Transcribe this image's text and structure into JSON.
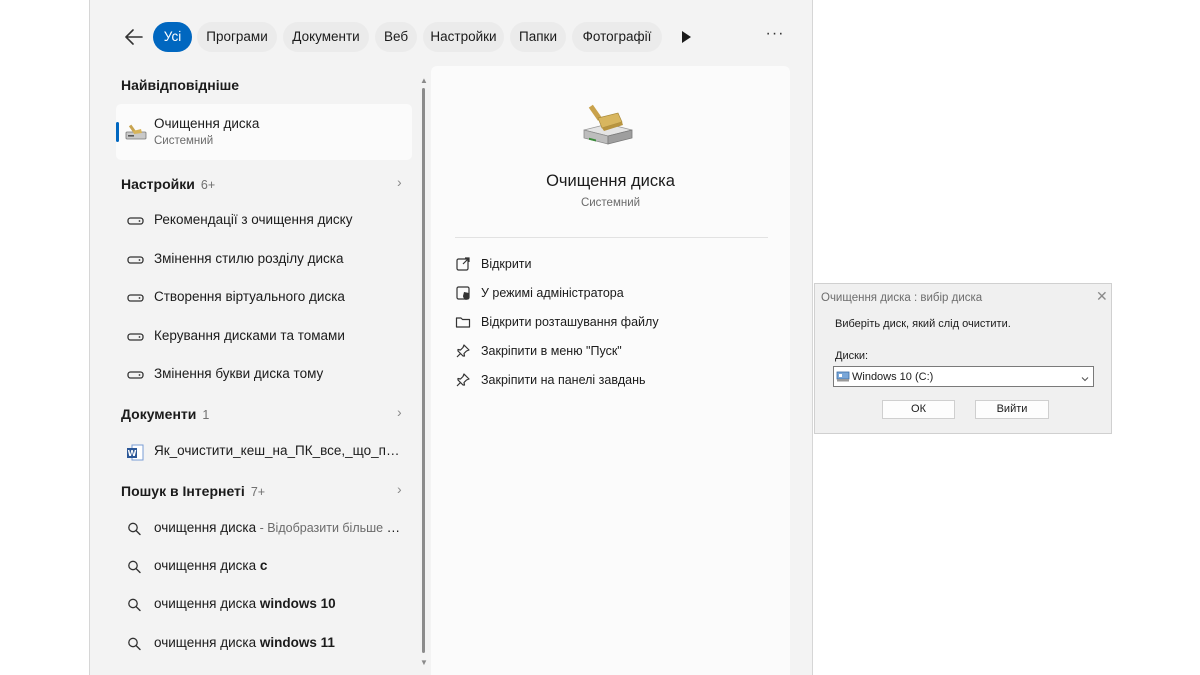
{
  "filters": {
    "items": [
      {
        "label": "Усі",
        "active": true
      },
      {
        "label": "Програми"
      },
      {
        "label": "Документи"
      },
      {
        "label": "Веб"
      },
      {
        "label": "Настройки"
      },
      {
        "label": "Папки"
      },
      {
        "label": "Фотографії"
      }
    ],
    "more_icon": "play-triangle-icon",
    "options_icon": "more-dots-icon",
    "options_label": "···"
  },
  "best_match": {
    "heading": "Найвідповідніше",
    "title": "Очищення диска",
    "subtitle": "Системний",
    "icon": "disk-cleanup-icon"
  },
  "settings_section": {
    "heading": "Настройки",
    "count": "6+",
    "items": [
      {
        "label": "Рекомендації з очищення диску"
      },
      {
        "label": "Змінення стилю розділу диска"
      },
      {
        "label": "Створення віртуального диска"
      },
      {
        "label": "Керування дисками та томами"
      },
      {
        "label": "Змінення букви диска тому"
      }
    ]
  },
  "documents_section": {
    "heading": "Документи",
    "count": "1",
    "items": [
      {
        "label": "Як_очистити_кеш_на_ПК_все,_що_потрібно_знати.docx"
      }
    ]
  },
  "web_section": {
    "heading": "Пошук в Інтернеті",
    "count": "7+",
    "items": [
      {
        "query": "очищення диска",
        "bold": "",
        "hint": " - Відобразити більше результатів"
      },
      {
        "query": "очищення диска ",
        "bold": "c",
        "hint": ""
      },
      {
        "query": "очищення диска ",
        "bold": "windows 10",
        "hint": ""
      },
      {
        "query": "очищення диска ",
        "bold": "windows 11",
        "hint": ""
      }
    ]
  },
  "detail": {
    "title": "Очищення диска",
    "subtitle": "Системний",
    "actions": [
      {
        "label": "Відкрити",
        "icon": "open-external-icon"
      },
      {
        "label": "У режимі адміністратора",
        "icon": "admin-shield-icon"
      },
      {
        "label": "Відкрити розташування файлу",
        "icon": "folder-icon"
      },
      {
        "label": "Закріпити в меню \"Пуск\"",
        "icon": "pin-icon"
      },
      {
        "label": "Закріпити на панелі завдань",
        "icon": "pin-icon"
      }
    ]
  },
  "dialog": {
    "title": "Очищення диска : вибір диска",
    "message": "Виберіть диск, який слід очистити.",
    "drives_label": "Диски:",
    "selected_drive": "Windows 10 (C:)",
    "ok_label": "ОК",
    "exit_label": "Вийти"
  },
  "colors": {
    "accent": "#0067c0",
    "panel_bg": "#f3f3f3",
    "card_bg": "#fbfbfb",
    "dialog_bg": "#f0f0f0"
  }
}
